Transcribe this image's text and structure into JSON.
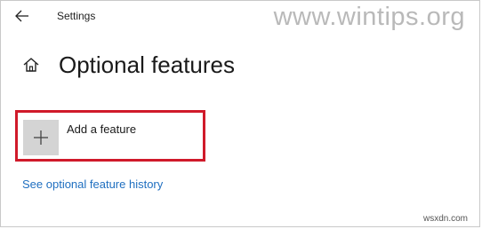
{
  "window": {
    "app_title": "Settings",
    "watermark": "www.wintips.org",
    "footer_watermark": "wsxdn.com"
  },
  "header": {
    "title": "Optional features",
    "home_icon": "home-icon",
    "back_icon": "back-arrow-icon"
  },
  "add_feature": {
    "label": "Add a feature",
    "icon": "plus-icon",
    "highlight_color": "#d01a2a"
  },
  "links": {
    "history": "See optional feature history"
  },
  "colors": {
    "link": "#1f6fc0",
    "tile": "#d4d4d4"
  }
}
